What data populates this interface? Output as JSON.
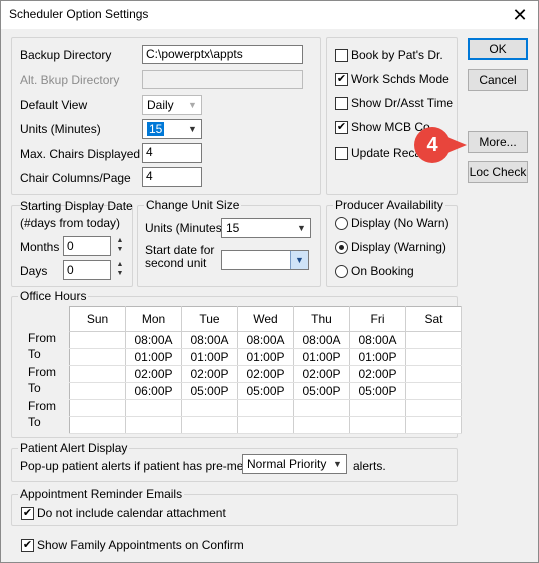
{
  "window": {
    "title": "Scheduler Option Settings"
  },
  "directories": {
    "backup_label": "Backup Directory",
    "backup_value": "C:\\powerptx\\appts",
    "alt_backup_label": "Alt. Bkup Directory",
    "alt_backup_value": ""
  },
  "view": {
    "default_view_label": "Default View",
    "default_view_value": "Daily",
    "units_label": "Units (Minutes)",
    "units_value": "15",
    "max_chairs_label": "Max. Chairs Displayed",
    "max_chairs_value": "4",
    "chair_columns_label": "Chair Columns/Page",
    "chair_columns_value": "4"
  },
  "checks": [
    {
      "label": "Book by Pat's Dr.",
      "checked": false
    },
    {
      "label": "Work Schds Mode",
      "checked": true
    },
    {
      "label": "Show Dr/Asst Time",
      "checked": false
    },
    {
      "label": "Show MCB Co",
      "checked": true
    },
    {
      "label": "Update Reca",
      "checked": false
    }
  ],
  "buttons": {
    "ok": "OK",
    "cancel": "Cancel",
    "more": "More...",
    "loc_check": "Loc Check"
  },
  "annotation": {
    "step": "4",
    "color": "#e8453c"
  },
  "display_date": {
    "title": "Starting Display Date",
    "subtitle": "(#days from today)",
    "months_label": "Months",
    "months_value": "0",
    "days_label": "Days",
    "days_value": "0"
  },
  "unit_size": {
    "title": "Change Unit Size",
    "units_label": "Units (Minutes)",
    "units_value": "15",
    "start_label_1": "Start date for",
    "start_label_2": "second unit",
    "start_value": ""
  },
  "producer": {
    "title": "Producer Availability",
    "options": [
      {
        "label": "Display (No Warn)",
        "selected": false
      },
      {
        "label": "Display (Warning)",
        "selected": true
      },
      {
        "label": "On Booking",
        "selected": false
      }
    ]
  },
  "office_hours": {
    "title": "Office Hours",
    "days": [
      "Sun",
      "Mon",
      "Tue",
      "Wed",
      "Thu",
      "Fri",
      "Sat"
    ],
    "row_labels": [
      "From",
      "To",
      "From",
      "To",
      "From",
      "To"
    ],
    "rows": [
      [
        "",
        "08:00A",
        "08:00A",
        "08:00A",
        "08:00A",
        "08:00A",
        ""
      ],
      [
        "",
        "01:00P",
        "01:00P",
        "01:00P",
        "01:00P",
        "01:00P",
        ""
      ],
      [
        "",
        "02:00P",
        "02:00P",
        "02:00P",
        "02:00P",
        "02:00P",
        ""
      ],
      [
        "",
        "06:00P",
        "05:00P",
        "05:00P",
        "05:00P",
        "05:00P",
        ""
      ],
      [
        "",
        "",
        "",
        "",
        "",
        "",
        ""
      ],
      [
        "",
        "",
        "",
        "",
        "",
        "",
        ""
      ]
    ]
  },
  "patient_alert": {
    "title": "Patient Alert Display",
    "prefix": "Pop-up patient alerts if patient has pre-med or",
    "priority_value": "Normal Priority",
    "suffix": "alerts."
  },
  "reminder": {
    "title": "Appointment Reminder Emails",
    "no_attachment_label": "Do not include calendar attachment",
    "no_attachment_checked": true
  },
  "family": {
    "label": "Show Family Appointments on Confirm",
    "checked": true
  }
}
